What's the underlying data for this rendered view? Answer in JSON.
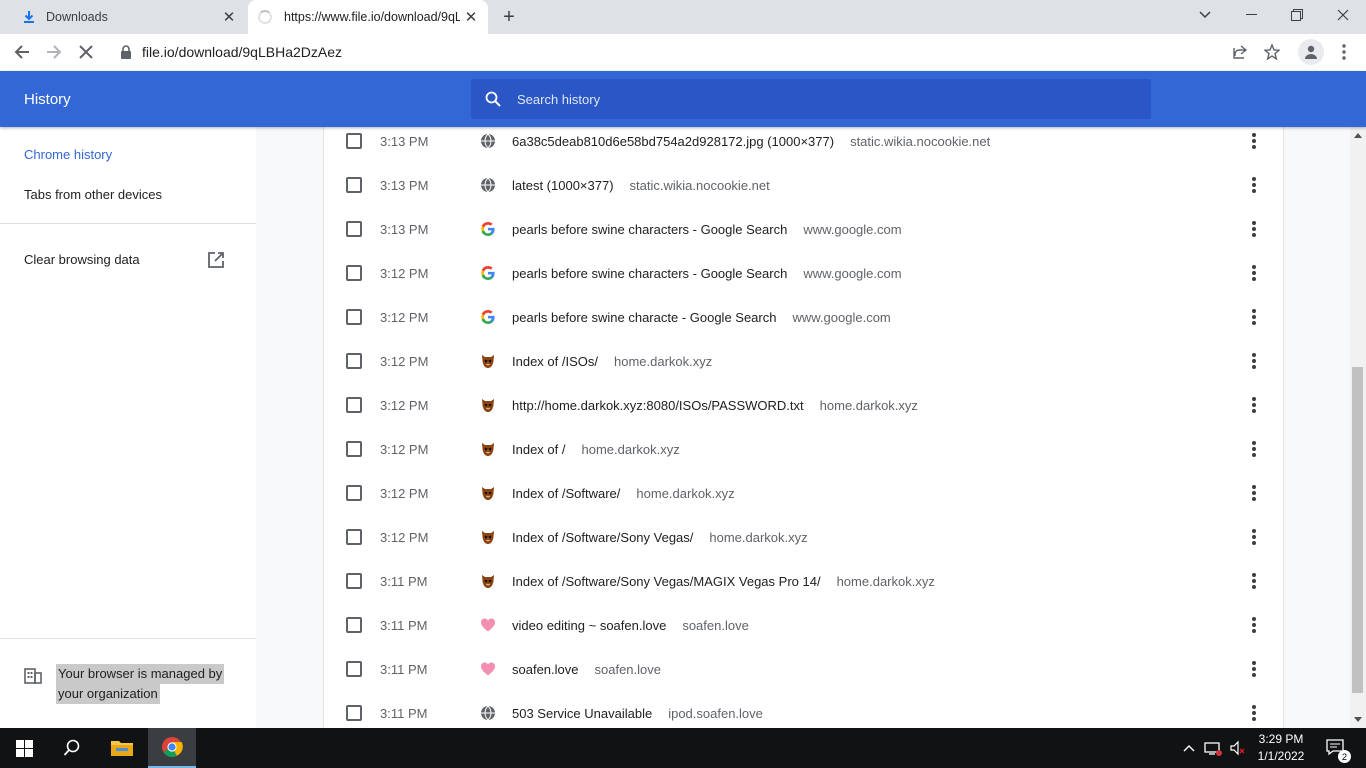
{
  "browser": {
    "tabs": [
      {
        "title": "Downloads",
        "icon": "download-icon"
      },
      {
        "title": "https://www.file.io/download/9qLBHa2DzAez",
        "icon": "loading-spinner-icon"
      }
    ],
    "url": "file.io/download/9qLBHa2DzAez"
  },
  "history": {
    "title": "History",
    "search_placeholder": "Search history"
  },
  "sidebar": {
    "chrome_history": "Chrome history",
    "tabs_other_devices": "Tabs from other devices",
    "clear_browsing": "Clear browsing data",
    "managed_line1": "Your browser is managed by",
    "managed_line2": "your organization"
  },
  "entries": [
    {
      "time": "3:13 PM",
      "title": "6a38c5deab810d6e58bd754a2d928172.jpg (1000×377)",
      "domain": "static.wikia.nocookie.net",
      "favicon": "globe-icon"
    },
    {
      "time": "3:13 PM",
      "title": "latest (1000×377)",
      "domain": "static.wikia.nocookie.net",
      "favicon": "globe-icon"
    },
    {
      "time": "3:13 PM",
      "title": "pearls before swine characters - Google Search",
      "domain": "www.google.com",
      "favicon": "google-icon"
    },
    {
      "time": "3:12 PM",
      "title": "pearls before swine characters - Google Search",
      "domain": "www.google.com",
      "favicon": "google-icon"
    },
    {
      "time": "3:12 PM",
      "title": "pearls before swine characte - Google Search",
      "domain": "www.google.com",
      "favicon": "google-icon"
    },
    {
      "time": "3:12 PM",
      "title": "Index of /ISOs/",
      "domain": "home.darkok.xyz",
      "favicon": "darkok-icon"
    },
    {
      "time": "3:12 PM",
      "title": "http://home.darkok.xyz:8080/ISOs/PASSWORD.txt",
      "domain": "home.darkok.xyz",
      "favicon": "darkok-icon"
    },
    {
      "time": "3:12 PM",
      "title": "Index of /",
      "domain": "home.darkok.xyz",
      "favicon": "darkok-icon"
    },
    {
      "time": "3:12 PM",
      "title": "Index of /Software/",
      "domain": "home.darkok.xyz",
      "favicon": "darkok-icon"
    },
    {
      "time": "3:12 PM",
      "title": "Index of /Software/Sony Vegas/",
      "domain": "home.darkok.xyz",
      "favicon": "darkok-icon"
    },
    {
      "time": "3:11 PM",
      "title": "Index of /Software/Sony Vegas/MAGIX Vegas Pro 14/",
      "domain": "home.darkok.xyz",
      "favicon": "darkok-icon"
    },
    {
      "time": "3:11 PM",
      "title": "video editing ~ soafen.love",
      "domain": "soafen.love",
      "favicon": "heart-icon"
    },
    {
      "time": "3:11 PM",
      "title": "soafen.love",
      "domain": "soafen.love",
      "favicon": "heart-icon"
    },
    {
      "time": "3:11 PM",
      "title": "503 Service Unavailable",
      "domain": "ipod.soafen.love",
      "favicon": "globe-icon"
    }
  ],
  "taskbar": {
    "time": "3:29 PM",
    "date": "1/1/2022",
    "notification_count": "2"
  },
  "colors": {
    "header_blue": "#3367d6",
    "search_blue": "#2a56c6",
    "link_blue": "#3367d6"
  }
}
